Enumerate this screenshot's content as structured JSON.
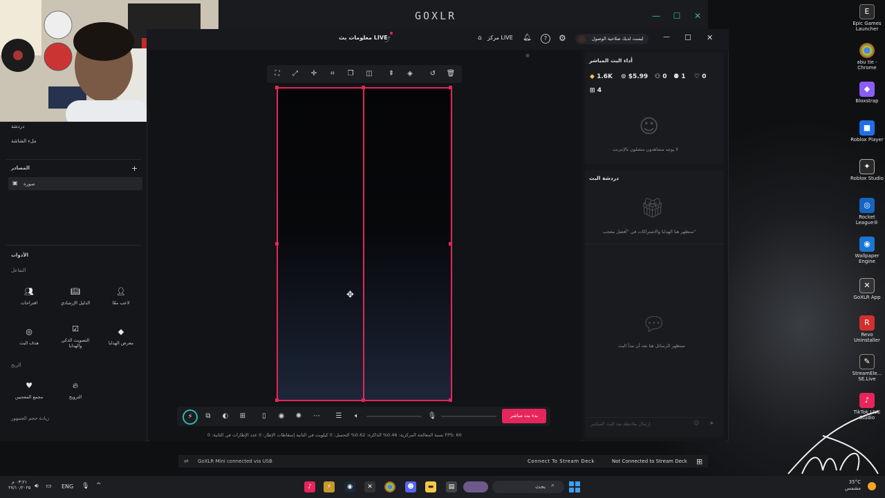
{
  "desktop": {
    "icons": [
      {
        "label": "Epic Games Launcher",
        "icon": "epic-games-icon",
        "color": "#2b2b2b"
      },
      {
        "label": "abu tie - Chrome",
        "icon": "chrome-icon",
        "color": "#e04436"
      },
      {
        "label": "Bloxstrap",
        "icon": "bloxstrap-icon",
        "color": "#8b5cf6"
      },
      {
        "label": "Roblox Player",
        "icon": "roblox-icon",
        "color": "#1f6feb"
      },
      {
        "label": "Roblox Studio",
        "icon": "roblox-studio-icon",
        "color": "#2a2a2a"
      },
      {
        "label": "Rocket League®",
        "icon": "rocket-league-icon",
        "color": "#1565c0"
      },
      {
        "label": "Wallpaper Engine",
        "icon": "wallpaper-engine-icon",
        "color": "#1976d2"
      },
      {
        "label": "GoXLR App",
        "icon": "goxlr-icon",
        "color": "#333"
      },
      {
        "label": "Revo Uninstaller",
        "icon": "revo-icon",
        "color": "#d32f2f"
      },
      {
        "label": "StreamEle... SE.Live",
        "icon": "streamelements-icon",
        "color": "#222"
      },
      {
        "label": "TikTok LIVE Studio",
        "icon": "tiktok-icon",
        "color": "#e6255a"
      }
    ]
  },
  "goxlr": {
    "logo": "GOXLR",
    "accent": "#2fb7b0"
  },
  "app": {
    "title": "معلومات بث LIVE",
    "live_center": "مركز LIVE",
    "account": "ليست لديك صلاحية الوصول",
    "accent": "#e6255a"
  },
  "left_panel": {
    "top_items": [
      "دردشة",
      "ملء الشاشة"
    ],
    "sources_title": "المصادر",
    "source_item": "صورة",
    "tools_title": "الأدوات",
    "interaction_label": "التفاعل",
    "tools_interaction": [
      {
        "label": "اقتراحات",
        "icon": "users-icon"
      },
      {
        "label": "الدليل الإرشادي",
        "icon": "book-icon"
      },
      {
        "label": "لاعب معًا",
        "icon": "player-icon"
      },
      {
        "label": "هدف البث",
        "icon": "target-icon"
      },
      {
        "label": "التصويت الذكي والهدايا",
        "icon": "vote-icon"
      },
      {
        "label": "معرض الهدايا",
        "icon": "gift-gallery-icon"
      }
    ],
    "revenue_label": "الربح",
    "tools_revenue": [
      {
        "label": "مجمع المعجبين",
        "icon": "heart-icon"
      },
      {
        "label": "الترويج",
        "icon": "flame-icon"
      }
    ],
    "audience_label": "زيادة حجم الجمهور"
  },
  "canvas": {
    "bottom": {
      "go_live": "بدء بث مباشر"
    },
    "stats": "نسبة المعالجة المركزية: 0.46%    الذاكرة: 0.62%    التحميل: 0 كيلوبت في الثانية    إسقاطات الإطار: 0    عدد الإطارات في الثانية: 0    FPS: 60"
  },
  "right_panel": {
    "performance_title": "أداء البث المباشر",
    "stats": [
      {
        "icon": "diamond-icon",
        "value": "1.6K"
      },
      {
        "icon": "dollar-icon",
        "value": "$5.99"
      },
      {
        "icon": "viewers-icon",
        "value": "0"
      },
      {
        "icon": "new-followers-icon",
        "value": "1"
      },
      {
        "icon": "likes-icon",
        "value": "0"
      },
      {
        "icon": "gifts-icon",
        "value": "4"
      }
    ],
    "viewers_empty": "لا يوجد مشاهدون متصلون بالإنترنت",
    "chat_title": "دردشة البث",
    "gifts_empty": "ستظهر هنا الهدايا والاشتراكات في \"أفضل معجب\"",
    "messages_empty": "ستظهر الرسائل هنا بعد أن تبدأ البث",
    "input_placeholder": "إرسال ملاحظة بعد البث المباشر"
  },
  "status_bar": {
    "usb": "GoXLR Mini connected via USB",
    "deck_connect": "Connect To Stream Deck",
    "deck_status": "Not Connected to Stream Deck"
  },
  "taskbar": {
    "time": "٠٣:٢١ م",
    "date": "٢٧/١٠/٢٠٢٥",
    "lang": "ENG",
    "search": "بحث",
    "weather": "35°C",
    "weather_text": "مشمس"
  }
}
